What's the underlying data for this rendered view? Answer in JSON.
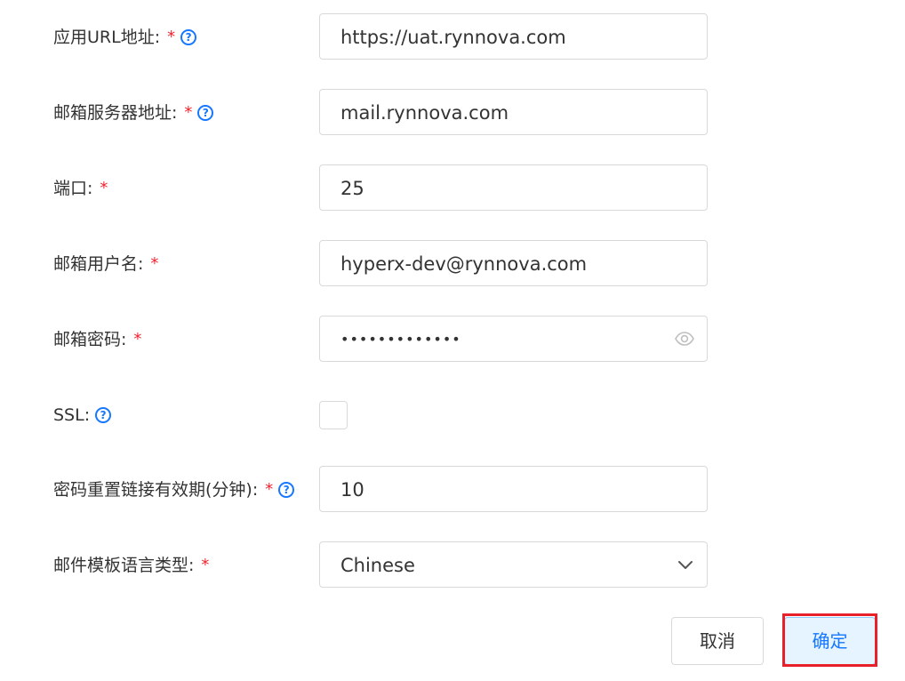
{
  "form": {
    "app_url": {
      "label": "应用URL地址:",
      "required": "*",
      "help": "?",
      "value": "https://uat.rynnova.com"
    },
    "mail_server": {
      "label": "邮箱服务器地址:",
      "required": "*",
      "help": "?",
      "value": "mail.rynnova.com"
    },
    "port": {
      "label": "端口:",
      "required": "*",
      "value": "25"
    },
    "mail_username": {
      "label": "邮箱用户名:",
      "required": "*",
      "value": "hyperx-dev@rynnova.com"
    },
    "mail_password": {
      "label": "邮箱密码:",
      "required": "*",
      "value": "•••••••••••••"
    },
    "ssl": {
      "label": "SSL:",
      "help": "?",
      "checked": false
    },
    "reset_link_validity": {
      "label": "密码重置链接有效期(分钟):",
      "required": "*",
      "help": "?",
      "value": "10"
    },
    "mail_template_language": {
      "label": "邮件模板语言类型:",
      "required": "*",
      "value": "Chinese"
    }
  },
  "actions": {
    "cancel_label": "取消",
    "ok_label": "确定"
  },
  "colors": {
    "required": "#f5222d",
    "accent": "#1677ff",
    "highlight": "#e8202a"
  }
}
